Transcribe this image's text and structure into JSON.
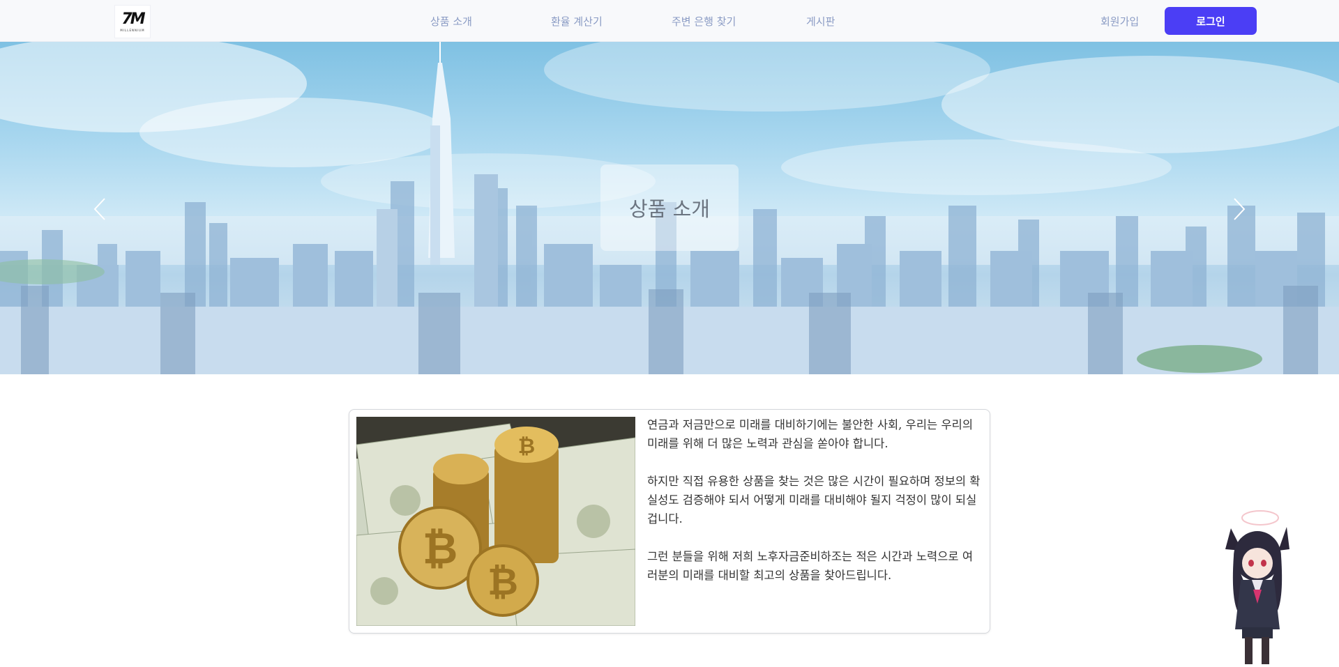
{
  "header": {
    "logo_text": "7M",
    "logo_sub": "MILLENNIUM",
    "nav": [
      "상품 소개",
      "환율 계산기",
      "주변 은행 찾기",
      "게시판"
    ],
    "signup_label": "회원가입",
    "login_label": "로그인",
    "accent_color": "#4b3ef5",
    "nav_color": "#8a9bc4"
  },
  "hero": {
    "caption": "상품 소개",
    "prev_icon": "chevron-left-icon",
    "next_icon": "chevron-right-icon"
  },
  "intro": {
    "image": "bitcoin-and-dollars-photo",
    "paragraphs": [
      " 연금과 저금만으로 미래를 대비하기에는 불안한 사회, 우리는 우리의 미래를 위해 더 많은 노력과 관심을 쏟아야 합니다.",
      " 하지만 직접 유용한 상품을 찾는 것은 많은 시간이 필요하며 정보의 확실성도 검증해야 되서 어떻게 미래를 대비해야 될지 걱정이 많이 되실겁니다.",
      "  그런 분들을 위해 저희 노후자금준비하조는 적은 시간과 노력으로 여러분의 미래를 대비할 최고의 상품을 찾아드립니다."
    ]
  },
  "mascot": "cat-ear-girl-mascot"
}
